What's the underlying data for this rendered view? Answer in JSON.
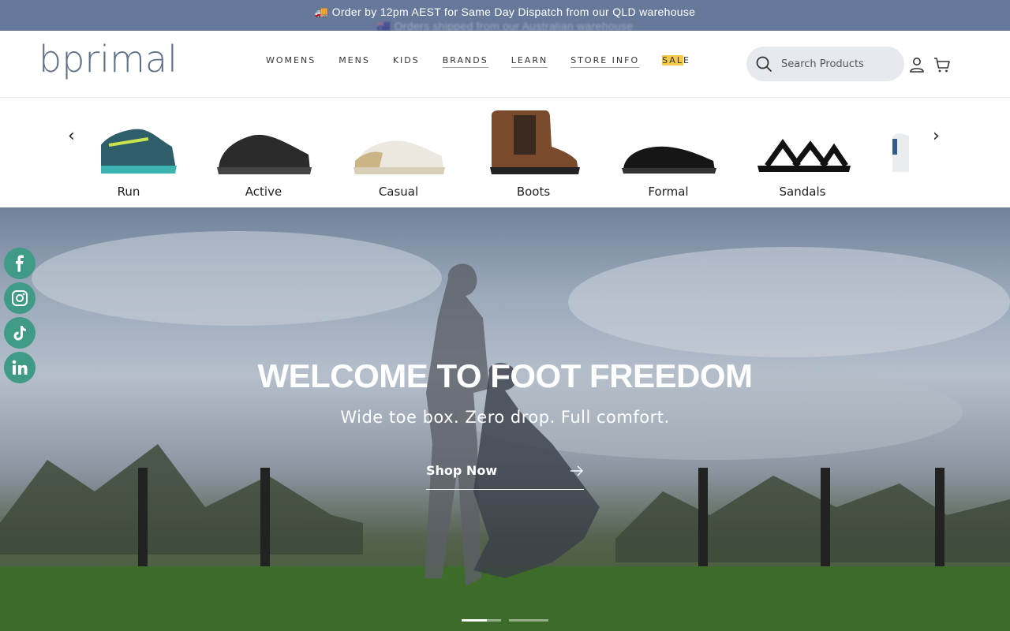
{
  "announcement": {
    "line1": "🚚 Order by 12pm AEST for Same Day Dispatch from our QLD warehouse",
    "line2": "🇦🇺 Orders shipped from our Australian warehouse"
  },
  "header": {
    "logo_text": "bprimal",
    "nav": [
      {
        "label": "WOMENS"
      },
      {
        "label": "MENS"
      },
      {
        "label": "KIDS"
      },
      {
        "label": "BRANDS"
      },
      {
        "label": "LEARN"
      },
      {
        "label": "STORE INFO"
      },
      {
        "label_a": "SAL",
        "label_b": "E"
      }
    ],
    "search": {
      "placeholder": "Search Products"
    }
  },
  "categories": {
    "prev_arrow": "‹",
    "next_arrow": "›",
    "items": [
      {
        "label": "Run",
        "color": "#2f5e6b"
      },
      {
        "label": "Active",
        "color": "#2b2b2b"
      },
      {
        "label": "Casual",
        "color": "#e8e4dc"
      },
      {
        "label": "Boots",
        "color": "#7a4a2c"
      },
      {
        "label": "Formal",
        "color": "#161616"
      },
      {
        "label": "Sandals",
        "color": "#111111"
      }
    ]
  },
  "hero": {
    "title": "WELCOME TO FOOT FREEDOM",
    "subtitle": "Wide toe box. Zero drop. Full comfort.",
    "cta": "Shop Now",
    "slides": 2,
    "active_slide": 1
  },
  "social": [
    "facebook-icon",
    "instagram-icon",
    "tiktok-icon",
    "linkedin-icon"
  ],
  "colors": {
    "announcement_bg": "#66799b",
    "social_bg": "#3f9a86",
    "sale_highlight": "#f7c948"
  }
}
